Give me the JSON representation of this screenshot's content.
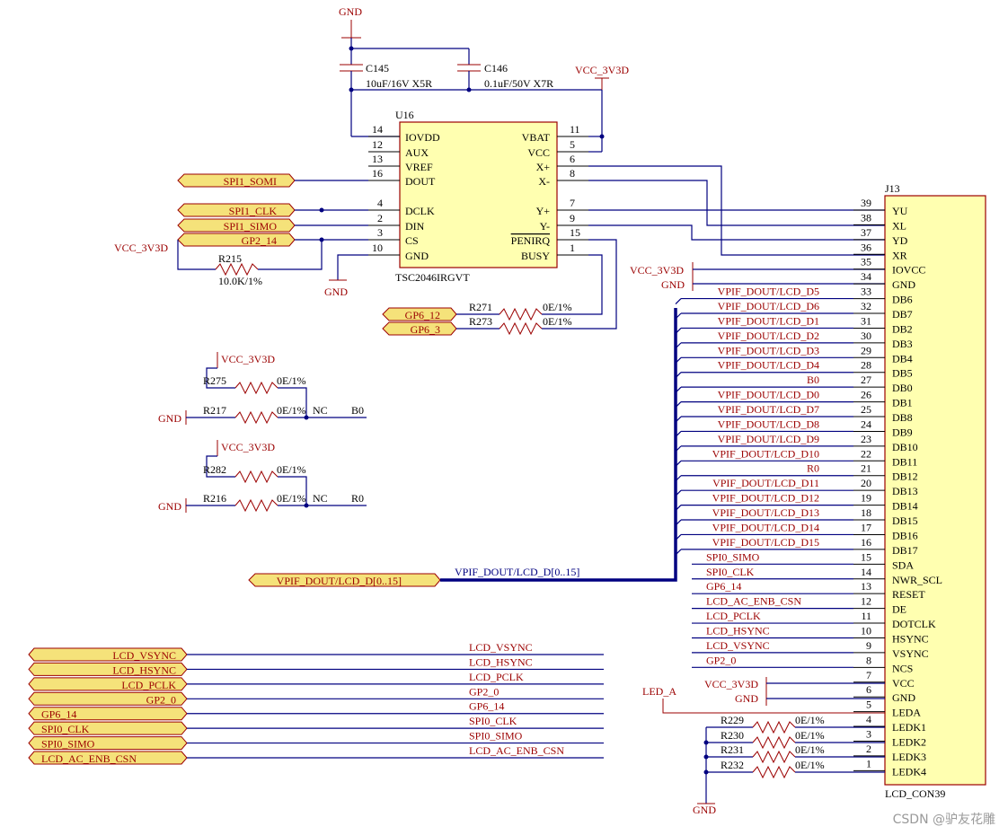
{
  "gnd_label": "GND",
  "vcc_label": "VCC_3V3D",
  "caps": [
    {
      "ref": "C145",
      "value": "10uF/16V X5R"
    },
    {
      "ref": "C146",
      "value": "0.1uF/50V X7R"
    }
  ],
  "u16": {
    "ref": "U16",
    "part": "TSC2046IRGVT",
    "left_pins": [
      {
        "num": "14",
        "name": "IOVDD"
      },
      {
        "num": "12",
        "name": "AUX"
      },
      {
        "num": "13",
        "name": "VREF"
      },
      {
        "num": "16",
        "name": "DOUT"
      },
      {
        "num": "4",
        "name": "DCLK"
      },
      {
        "num": "2",
        "name": "DIN"
      },
      {
        "num": "3",
        "name": "CS"
      },
      {
        "num": "10",
        "name": "GND"
      }
    ],
    "right_pins": [
      {
        "num": "11",
        "name": "VBAT"
      },
      {
        "num": "5",
        "name": "VCC"
      },
      {
        "num": "6",
        "name": "X+"
      },
      {
        "num": "8",
        "name": "X-"
      },
      {
        "num": "7",
        "name": "Y+"
      },
      {
        "num": "9",
        "name": "Y-"
      },
      {
        "num": "15",
        "name": "PENIRQ"
      },
      {
        "num": "1",
        "name": "BUSY"
      }
    ]
  },
  "spi_ports": [
    "SPI1_SOMI",
    "SPI1_CLK",
    "SPI1_SIMO",
    "GP2_14"
  ],
  "resistors": [
    {
      "ref": "R215",
      "value": "10.0K/1%"
    },
    {
      "ref": "R271",
      "value": "0E/1%"
    },
    {
      "ref": "R273",
      "value": "0E/1%"
    },
    {
      "ref": "R275",
      "value": "0E/1%"
    },
    {
      "ref": "R217",
      "value": "0E/1%"
    },
    {
      "ref": "R282",
      "value": "0E/1%"
    },
    {
      "ref": "R216",
      "value": "0E/1%"
    },
    {
      "ref": "R229",
      "value": "0E/1%"
    },
    {
      "ref": "R230",
      "value": "0E/1%"
    },
    {
      "ref": "R231",
      "value": "0E/1%"
    },
    {
      "ref": "R232",
      "value": "0E/1%"
    }
  ],
  "gp6_ports": [
    "GP6_12",
    "GP6_3"
  ],
  "nc_label": "NC",
  "b0": "B0",
  "r0": "R0",
  "bus_port": "VPIF_DOUT/LCD_D[0..15]",
  "bus_label": "VPIF_DOUT/LCD_D[0..15]",
  "j13": {
    "ref": "J13",
    "part": "LCD_CON39",
    "pins": [
      {
        "num": "39",
        "name": "YU",
        "net": ""
      },
      {
        "num": "38",
        "name": "XL",
        "net": ""
      },
      {
        "num": "37",
        "name": "YD",
        "net": ""
      },
      {
        "num": "36",
        "name": "XR",
        "net": ""
      },
      {
        "num": "35",
        "name": "IOVCC",
        "net": "VCC_3V3D"
      },
      {
        "num": "34",
        "name": "GND",
        "net": "GND"
      },
      {
        "num": "33",
        "name": "DB6",
        "net": "VPIF_DOUT/LCD_D5"
      },
      {
        "num": "32",
        "name": "DB7",
        "net": "VPIF_DOUT/LCD_D6"
      },
      {
        "num": "31",
        "name": "DB2",
        "net": "VPIF_DOUT/LCD_D1"
      },
      {
        "num": "30",
        "name": "DB3",
        "net": "VPIF_DOUT/LCD_D2"
      },
      {
        "num": "29",
        "name": "DB4",
        "net": "VPIF_DOUT/LCD_D3"
      },
      {
        "num": "28",
        "name": "DB5",
        "net": "VPIF_DOUT/LCD_D4"
      },
      {
        "num": "27",
        "name": "DB0",
        "net": "B0"
      },
      {
        "num": "26",
        "name": "DB1",
        "net": "VPIF_DOUT/LCD_D0"
      },
      {
        "num": "25",
        "name": "DB8",
        "net": "VPIF_DOUT/LCD_D7"
      },
      {
        "num": "24",
        "name": "DB9",
        "net": "VPIF_DOUT/LCD_D8"
      },
      {
        "num": "23",
        "name": "DB10",
        "net": "VPIF_DOUT/LCD_D9"
      },
      {
        "num": "22",
        "name": "DB11",
        "net": "VPIF_DOUT/LCD_D10"
      },
      {
        "num": "21",
        "name": "DB12",
        "net": "R0"
      },
      {
        "num": "20",
        "name": "DB13",
        "net": "VPIF_DOUT/LCD_D11"
      },
      {
        "num": "19",
        "name": "DB14",
        "net": "VPIF_DOUT/LCD_D12"
      },
      {
        "num": "18",
        "name": "DB15",
        "net": "VPIF_DOUT/LCD_D13"
      },
      {
        "num": "17",
        "name": "DB16",
        "net": "VPIF_DOUT/LCD_D14"
      },
      {
        "num": "16",
        "name": "DB17",
        "net": "VPIF_DOUT/LCD_D15"
      },
      {
        "num": "15",
        "name": "SDA",
        "net": "SPI0_SIMO"
      },
      {
        "num": "14",
        "name": "NWR_SCL",
        "net": "SPI0_CLK"
      },
      {
        "num": "13",
        "name": "RESET",
        "net": "GP6_14"
      },
      {
        "num": "12",
        "name": "DE",
        "net": "LCD_AC_ENB_CSN"
      },
      {
        "num": "11",
        "name": "DOTCLK",
        "net": "LCD_PCLK"
      },
      {
        "num": "10",
        "name": "HSYNC",
        "net": "LCD_HSYNC"
      },
      {
        "num": "9",
        "name": "VSYNC",
        "net": "LCD_VSYNC"
      },
      {
        "num": "8",
        "name": "NCS",
        "net": "GP2_0"
      },
      {
        "num": "7",
        "name": "VCC",
        "net": "VCC_3V3D"
      },
      {
        "num": "6",
        "name": "GND",
        "net": "GND"
      },
      {
        "num": "5",
        "name": "LEDA",
        "net": ""
      },
      {
        "num": "4",
        "name": "LEDK1",
        "net": ""
      },
      {
        "num": "3",
        "name": "LEDK2",
        "net": ""
      },
      {
        "num": "2",
        "name": "LEDK3",
        "net": ""
      },
      {
        "num": "1",
        "name": "LEDK4",
        "net": ""
      }
    ]
  },
  "led_a": "LED_A",
  "lcd_ports": [
    {
      "port": "LCD_VSYNC",
      "net": "LCD_VSYNC"
    },
    {
      "port": "LCD_HSYNC",
      "net": "LCD_HSYNC"
    },
    {
      "port": "LCD_PCLK",
      "net": "LCD_PCLK"
    },
    {
      "port": "GP2_0",
      "net": "GP2_0"
    },
    {
      "port": "GP6_14",
      "net": "GP6_14"
    },
    {
      "port": "SPI0_CLK",
      "net": "SPI0_CLK"
    },
    {
      "port": "SPI0_SIMO",
      "net": "SPI0_SIMO"
    },
    {
      "port": "LCD_AC_ENB_CSN",
      "net": "LCD_AC_ENB_CSN"
    }
  ],
  "watermark": "CSDN @驴友花雕"
}
